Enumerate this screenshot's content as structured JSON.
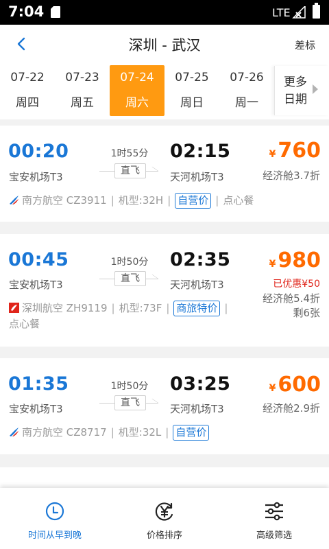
{
  "status_bar": {
    "time": "7:04",
    "network": "LTE"
  },
  "header": {
    "title": "深圳 - 武汉",
    "right_label": "差标"
  },
  "dates": [
    {
      "date": "07-22",
      "weekday": "周四",
      "active": false
    },
    {
      "date": "07-23",
      "weekday": "周五",
      "active": false
    },
    {
      "date": "07-24",
      "weekday": "周六",
      "active": true
    },
    {
      "date": "07-25",
      "weekday": "周日",
      "active": false
    },
    {
      "date": "07-26",
      "weekday": "周一",
      "active": false
    }
  ],
  "more_dates": "更多日期",
  "flights": [
    {
      "dep_time": "00:20",
      "dep_airport": "宝安机场T3",
      "duration": "1时55分",
      "direct": "直飞",
      "arr_time": "02:15",
      "arr_airport": "天河机场T3",
      "currency": "¥",
      "price": "760",
      "discount": "",
      "cabin": "经济舱3.7折",
      "remaining": "",
      "airline": "南方航空 CZ3911",
      "aircraft": "机型:32H",
      "tag": "自营价",
      "meal": "点心餐"
    },
    {
      "dep_time": "00:45",
      "dep_airport": "宝安机场T3",
      "duration": "1时50分",
      "direct": "直飞",
      "arr_time": "02:35",
      "arr_airport": "天河机场T3",
      "currency": "¥",
      "price": "980",
      "discount": "已优惠¥50",
      "cabin": "经济舱5.4折",
      "remaining": "剩6张",
      "airline": "深圳航空 ZH9119",
      "aircraft": "机型:73F",
      "tag": "商旅特价",
      "meal": "点心餐"
    },
    {
      "dep_time": "01:35",
      "dep_airport": "宝安机场T3",
      "duration": "1时50分",
      "direct": "直飞",
      "arr_time": "03:25",
      "arr_airport": "天河机场T3",
      "currency": "¥",
      "price": "600",
      "discount": "",
      "cabin": "经济舱2.9折",
      "remaining": "",
      "airline": "南方航空 CZ8717",
      "aircraft": "机型:32L",
      "tag": "自营价",
      "meal": ""
    }
  ],
  "bottom_tabs": [
    {
      "label": "时间从早到晚",
      "icon": "clock-icon",
      "active": true
    },
    {
      "label": "价格排序",
      "icon": "yen-circle-icon",
      "active": false
    },
    {
      "label": "高级筛选",
      "icon": "filter-sliders-icon",
      "active": false
    }
  ],
  "colors": {
    "accent": "#1a77d6",
    "active_date": "#ff9a11",
    "price": "#ff6a00",
    "discount": "#e0251b"
  }
}
